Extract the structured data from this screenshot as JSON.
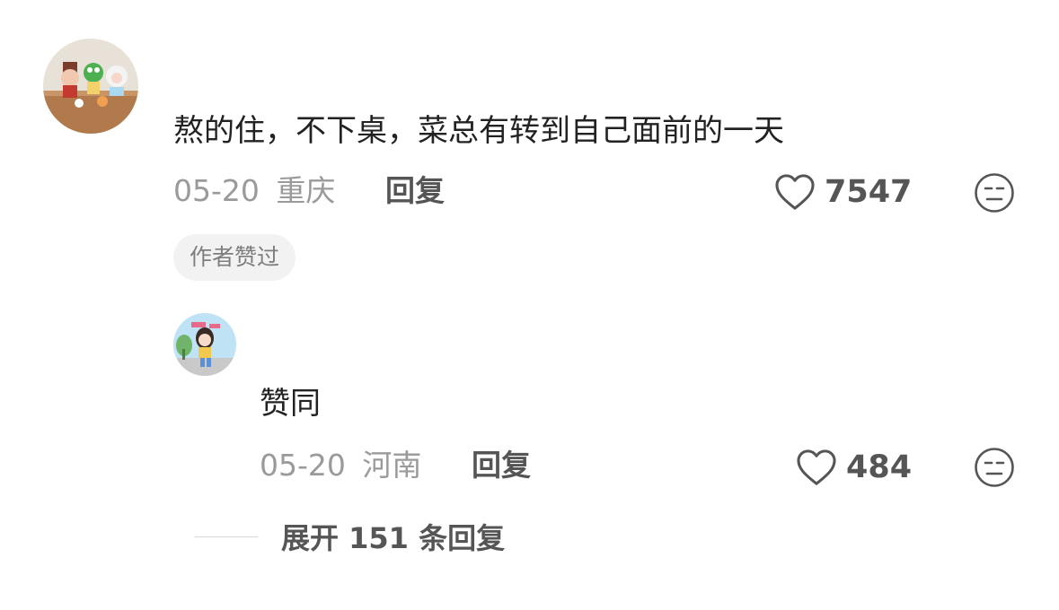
{
  "comment": {
    "avatar_icon": "toy-figures-avatar",
    "text": "熬的住，不下桌，菜总有转到自己面前的一天",
    "date": "05-20",
    "location": "重庆",
    "reply_label": "回复",
    "like_count": "7547",
    "badge": "作者赞过"
  },
  "reply": {
    "avatar_icon": "cartoon-girl-avatar",
    "text": "赞同",
    "date": "05-20",
    "location": "河南",
    "reply_label": "回复",
    "like_count": "484"
  },
  "expand": {
    "label": "展开 151 条回复"
  },
  "colors": {
    "text_primary": "#222222",
    "text_meta": "#9a9a9a",
    "text_action": "#555555",
    "badge_bg": "#f2f2f2"
  }
}
